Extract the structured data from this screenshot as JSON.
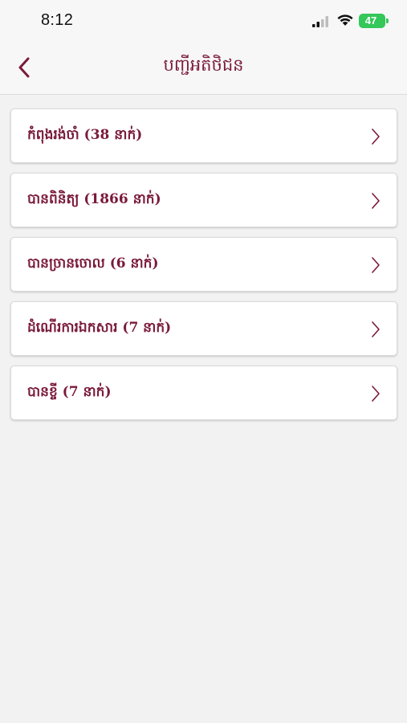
{
  "status_bar": {
    "time": "8:12",
    "battery": "47"
  },
  "nav": {
    "title": "បញ្ជីអតិថិជន",
    "back_icon": "chevron-left-icon"
  },
  "items": [
    {
      "label": "កំពុងរង់ចាំ (38 នាក់)"
    },
    {
      "label": "បានពិនិត្យ (1866 នាក់)"
    },
    {
      "label": "បានច្រានចោល (6 នាក់)"
    },
    {
      "label": "ដំណើរការឯកសារ (7 នាក់)"
    },
    {
      "label": "បានខ្ចី (7 នាក់)"
    }
  ],
  "colors": {
    "accent": "#7a1a3a",
    "battery": "#34c759",
    "background": "#f2f2f3"
  }
}
